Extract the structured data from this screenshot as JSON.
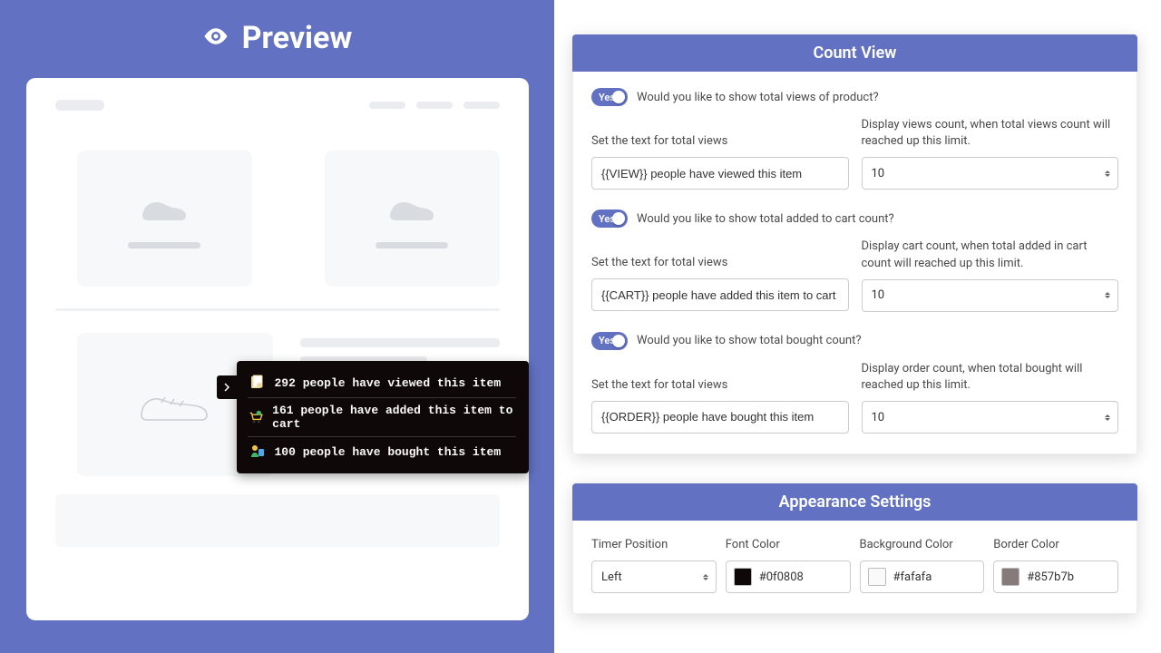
{
  "preview": {
    "title": "Preview",
    "popup": {
      "views": "292 people have viewed this item",
      "cart": "161 people have added this item to cart",
      "bought": "100 people have bought this item"
    }
  },
  "count_view": {
    "heading": "Count View",
    "views": {
      "question": "Would you like to show total views of product?",
      "toggle": "Yes",
      "text_label": "Set the text for total views",
      "text_value": "{{VIEW}} people have viewed this item",
      "limit_label": "Display views count, when total views count will reached up this limit.",
      "limit_value": "10"
    },
    "cart": {
      "question": "Would you like to show total added to cart count?",
      "toggle": "Yes",
      "text_label": "Set the text for total views",
      "text_value": "{{CART}} people have added this item to cart",
      "limit_label": "Display cart count, when total added in cart count will reached up this limit.",
      "limit_value": "10"
    },
    "bought": {
      "question": "Would you like to show total bought count?",
      "toggle": "Yes",
      "text_label": "Set the text for total views",
      "text_value": "{{ORDER}} people have bought this item",
      "limit_label": "Display order count, when total bought will reached up this limit.",
      "limit_value": "10"
    }
  },
  "appearance": {
    "heading": "Appearance Settings",
    "timer_position": {
      "label": "Timer Position",
      "value": "Left"
    },
    "font_color": {
      "label": "Font Color",
      "value": "#0f0808"
    },
    "bg_color": {
      "label": "Background Color",
      "value": "#fafafa"
    },
    "border_color": {
      "label": "Border Color",
      "value": "#857b7b"
    }
  }
}
